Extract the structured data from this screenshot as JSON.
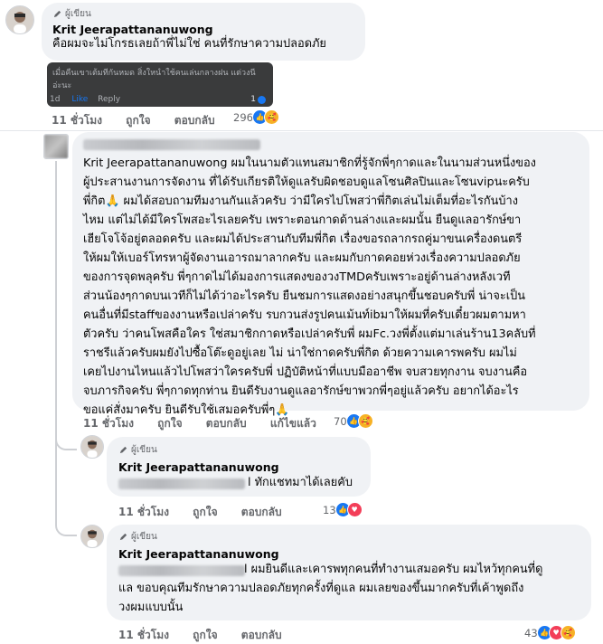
{
  "top_comment": {
    "badge": "ผู้เขียน",
    "author": "Krit Jeerapattananuwong",
    "text": "คือผมจะไม่โกรธเลยถ้าพี่ไม่ใช่ คนที่รักษาความปลอดภัย"
  },
  "embedded_reply": {
    "text_line1": "เมื่อคืนเขาเต้มทีกันหมด สิ่งใหนำใช้คนเล่นกลางฝน แต่วงนี",
    "text_line2": "อ่ะนะ",
    "time": "1d",
    "like": "Like",
    "reply": "Reply",
    "count": "1"
  },
  "top_actions": {
    "time": "11 ชั่วโมง",
    "like": "ถูกใจ",
    "reply": "ตอบกลับ",
    "reactions": "296"
  },
  "long_comment": {
    "lines": [
      "Krit Jeerapattananuwong ผมในนามตัวแทนสมาชิกที่รู้จักพี่ๆกาดและในนามส่วนหนึ่งของ",
      "ผู้ประสานงานการจัดงาน ที่ได้รับเกียรติให้ดูแลรับผิดชอบดูแลโซนศิลปินและโซนvipนะครับ",
      "พี่กิต🙏 ผมได้สอบถามทีมงานกันแล้วครับ ว่ามีใครไปโพสว่าพี่กิตเล่นไม่เต็มที่อะไรกันบ้าง",
      "ไหม แต่ไม่ได้มีใครโพสอะไรเลยครับ เพราะตอนกาดด้านล่างและผมนั้น ยืนดูแลอารักษ์ขา",
      "เฮียโจโจ้อยู่ตลอดครับ และผมได้ประสานกับทีมพี่กิต เรื่องขอรถลากรถคู่มาขนเครื่องดนตรี",
      "ให้ผมให้เบอร์โทรหาผู้จัดงานเอารถมาลากครับ และผมกับกาดคอยห่วงเรื่องความปลอดภัย",
      "ของการจุดพลุครับ พี่ๆกาดไม่ได้มองการแสดงของวงTMDครับเพราะอยู่ด้านล่างหลังเวที",
      "ส่วนน้องๆกาดบนเวทีก็ไม่ได้ว่าอะไรครับ ยืนชมการแสดงอย่างสนุกขึ้นชอบครับพี่ น่าจะเป็น",
      "คนอื่นที่มีstaffของงานหรือเปล่าครับ รบกวนส่งรูปคนเม้นท์ibมาให้ผมที่ครับเดี๋ยวผมตามหา",
      "ตัวครับ ว่าคนโพสคือใคร ใช่สมาชิกกาดหรือเปล่าครับพี่ ผมFc.วงพี่ตั้งแต่มาเล่นร้าน13คลับที่",
      "ราชรีแล้วครับผมยังไปซื้อโต๊ะดูอยู่เลย ไม่ น่าใช่กาดครับพี่กิต ด้วยความเคารพครับ ผมไม่",
      "เคยไปงานไหนแล้วไปโพสว่าใครครับพี่ ปฏิบัติหน้าที่แบบมืออาชีพ จบสวยทุกงาน จบงานคือ",
      "จบภารกิจครับ พี่ๆกาดทุกท่าน ยินดีรับงานดูแลอารักษ์ขาพวกพี่ๆอยู่แล้วครับ อยากได้อะไร",
      "ขอแค่สั่งมาครับ ยินดีรับใช้เสมอครับพี่ๆ🙏"
    ]
  },
  "long_actions": {
    "time": "11 ชั่วโมง",
    "like": "ถูกใจ",
    "reply": "ตอบกลับ",
    "edited": "แก้ไขแล้ว",
    "reactions": "70"
  },
  "reply1": {
    "badge": "ผู้เขียน",
    "author": "Krit Jeerapattananuwong",
    "text": "l ทักแชทมาได้เลยคับ",
    "time": "11 ชั่วโมง",
    "like": "ถูกใจ",
    "reply": "ตอบกลับ",
    "reactions": "13"
  },
  "reply2": {
    "badge": "ผู้เขียน",
    "author": "Krit Jeerapattananuwong",
    "lines": [
      "l ผมยินดีและเคารพทุกคนที่ทำงานเสมอครับ ผมไหว้ทุกคนที่ดู",
      "แล ขอบคุณทีมรักษาความปลอดภัยทุกครั้งที่ดูแล ผมเลยของขึ้นมากครับที่เค้าพูดถึง",
      "วงผมแบบนั้น"
    ],
    "time": "11 ชั่วโมง",
    "like": "ถูกใจ",
    "reply": "ตอบกลับ",
    "reactions": "43"
  },
  "colors": {
    "like_blue": "#1877f2",
    "love_red": "#f33e58",
    "care_yellow": "#f7b125",
    "bubble": "#f0f2f5",
    "meta": "#65676b"
  }
}
